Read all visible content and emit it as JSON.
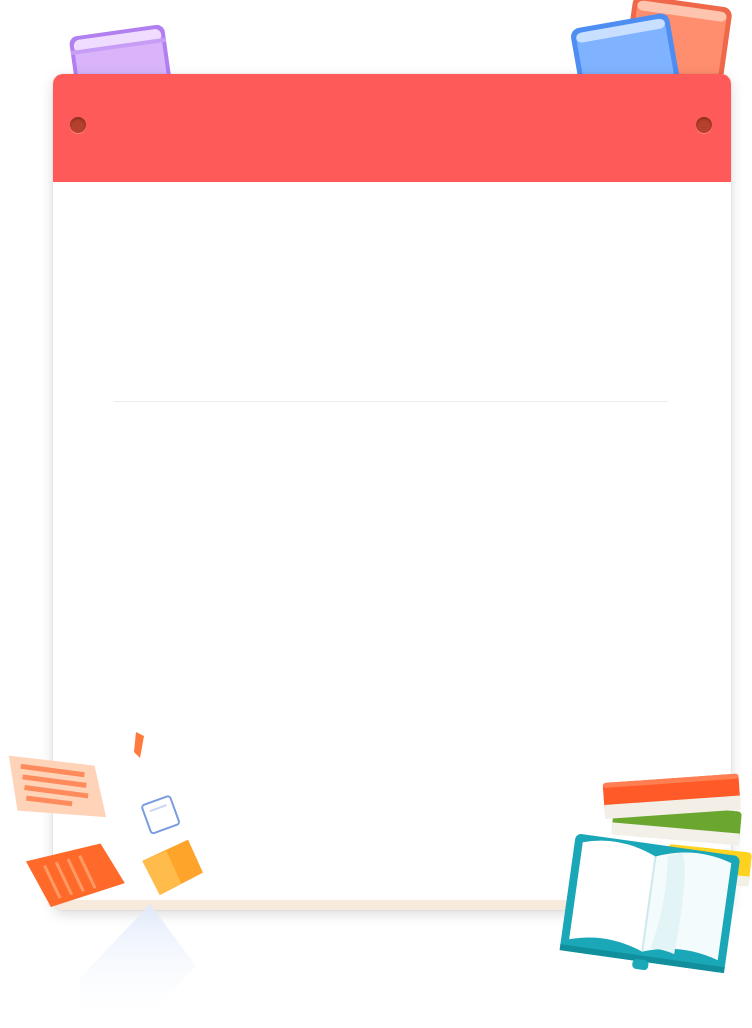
{
  "theme": {
    "header_color": "#fe5a5a",
    "pin_color": "#b5402c",
    "card_background": "#ffffff",
    "divider_color": "#ececec"
  },
  "decorations": {
    "top_left": "purple-book-icon",
    "top_right": "book-pair-icon",
    "bottom_left": "flying-papers-icon",
    "bottom_right": "book-stack-icon"
  }
}
